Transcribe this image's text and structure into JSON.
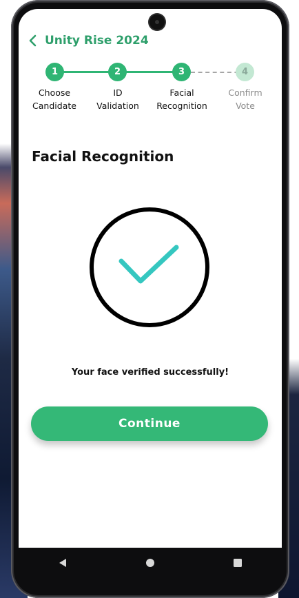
{
  "header": {
    "title": "Unity Rise 2024",
    "back_icon": "chevron-left-icon"
  },
  "stepper": {
    "steps": [
      {
        "number": "1",
        "label": "Choose\nCandidate",
        "status": "done"
      },
      {
        "number": "2",
        "label": "ID\nValidation",
        "status": "done"
      },
      {
        "number": "3",
        "label": "Facial\nRecognition",
        "status": "done"
      },
      {
        "number": "4",
        "label": "Confirm\nVote",
        "status": "todo"
      }
    ]
  },
  "main": {
    "title": "Facial Recognition",
    "status_icon": "check-circle-icon",
    "status_message": "Your face verified successfully!",
    "continue_label": "Continue"
  },
  "navbar": {
    "back": "triangle-back-icon",
    "home": "circle-home-icon",
    "recents": "square-recents-icon"
  },
  "colors": {
    "accent": "#2fb574",
    "title_green": "#2e9f6b",
    "check": "#35c7c0",
    "step_todo": "#c3e8d3"
  }
}
